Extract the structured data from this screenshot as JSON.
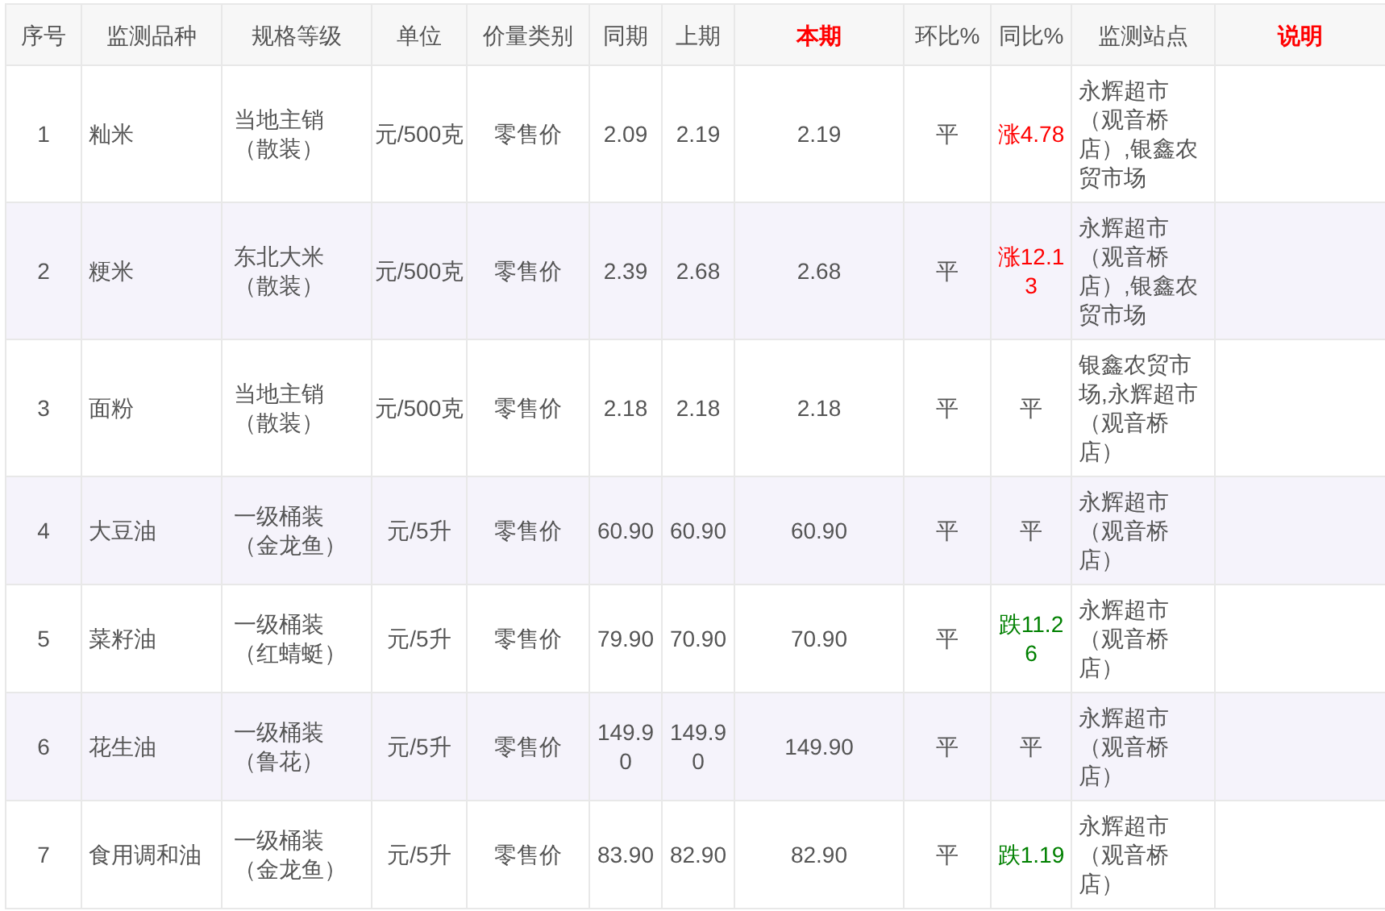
{
  "table": {
    "columns": [
      {
        "label": "序号",
        "highlight": false
      },
      {
        "label": "监测品种",
        "highlight": false
      },
      {
        "label": "规格等级",
        "highlight": false
      },
      {
        "label": "单位",
        "highlight": false
      },
      {
        "label": "价量类别",
        "highlight": false
      },
      {
        "label": "同期",
        "highlight": false
      },
      {
        "label": "上期",
        "highlight": false
      },
      {
        "label": "本期",
        "highlight": true
      },
      {
        "label": "环比%",
        "highlight": false
      },
      {
        "label": "同比%",
        "highlight": false
      },
      {
        "label": "监测站点",
        "highlight": false
      },
      {
        "label": "说明",
        "highlight": true
      }
    ],
    "rows": [
      {
        "no": "1",
        "variety": "籼米",
        "spec": "当地主销（散装）",
        "unit": "元/500克",
        "price_type": "零售价",
        "same_period": "2.09",
        "previous": "2.19",
        "current": "2.19",
        "mom": "平",
        "yoy": {
          "text": "涨4.78",
          "color": "#ff0000"
        },
        "stations": "永辉超市（观音桥店）,银鑫农贸市场"
      },
      {
        "no": "2",
        "variety": "粳米",
        "spec": "东北大米（散装）",
        "unit": "元/500克",
        "price_type": "零售价",
        "same_period": "2.39",
        "previous": "2.68",
        "current": "2.68",
        "mom": "平",
        "yoy": {
          "text": "涨12.13",
          "color": "#ff0000"
        },
        "stations": "永辉超市（观音桥店）,银鑫农贸市场"
      },
      {
        "no": "3",
        "variety": "面粉",
        "spec": "当地主销（散装）",
        "unit": "元/500克",
        "price_type": "零售价",
        "same_period": "2.18",
        "previous": "2.18",
        "current": "2.18",
        "mom": "平",
        "yoy": {
          "text": "平",
          "color": "#555555"
        },
        "stations": "银鑫农贸市场,永辉超市（观音桥店）"
      },
      {
        "no": "4",
        "variety": "大豆油",
        "spec": "一级桶装（金龙鱼）",
        "unit": "元/5升",
        "price_type": "零售价",
        "same_period": "60.90",
        "previous": "60.90",
        "current": "60.90",
        "mom": "平",
        "yoy": {
          "text": "平",
          "color": "#555555"
        },
        "stations": "永辉超市（观音桥店）"
      },
      {
        "no": "5",
        "variety": "菜籽油",
        "spec": "一级桶装（红蜻蜓）",
        "unit": "元/5升",
        "price_type": "零售价",
        "same_period": "79.90",
        "previous": "70.90",
        "current": "70.90",
        "mom": "平",
        "yoy": {
          "text": "跌11.26",
          "color": "#008000"
        },
        "stations": "永辉超市（观音桥店）"
      },
      {
        "no": "6",
        "variety": "花生油",
        "spec": "一级桶装（鲁花）",
        "unit": "元/5升",
        "price_type": "零售价",
        "same_period": "149.90",
        "previous": "149.90",
        "current": "149.90",
        "mom": "平",
        "yoy": {
          "text": "平",
          "color": "#555555"
        },
        "stations": "永辉超市（观音桥店）"
      },
      {
        "no": "7",
        "variety": "食用调和油",
        "spec": "一级桶装（金龙鱼）",
        "unit": "元/5升",
        "price_type": "零售价",
        "same_period": "83.90",
        "previous": "82.90",
        "current": "82.90",
        "mom": "平",
        "yoy": {
          "text": "跌1.19",
          "color": "#008000"
        },
        "stations": "永辉超市（观音桥店）"
      }
    ]
  }
}
